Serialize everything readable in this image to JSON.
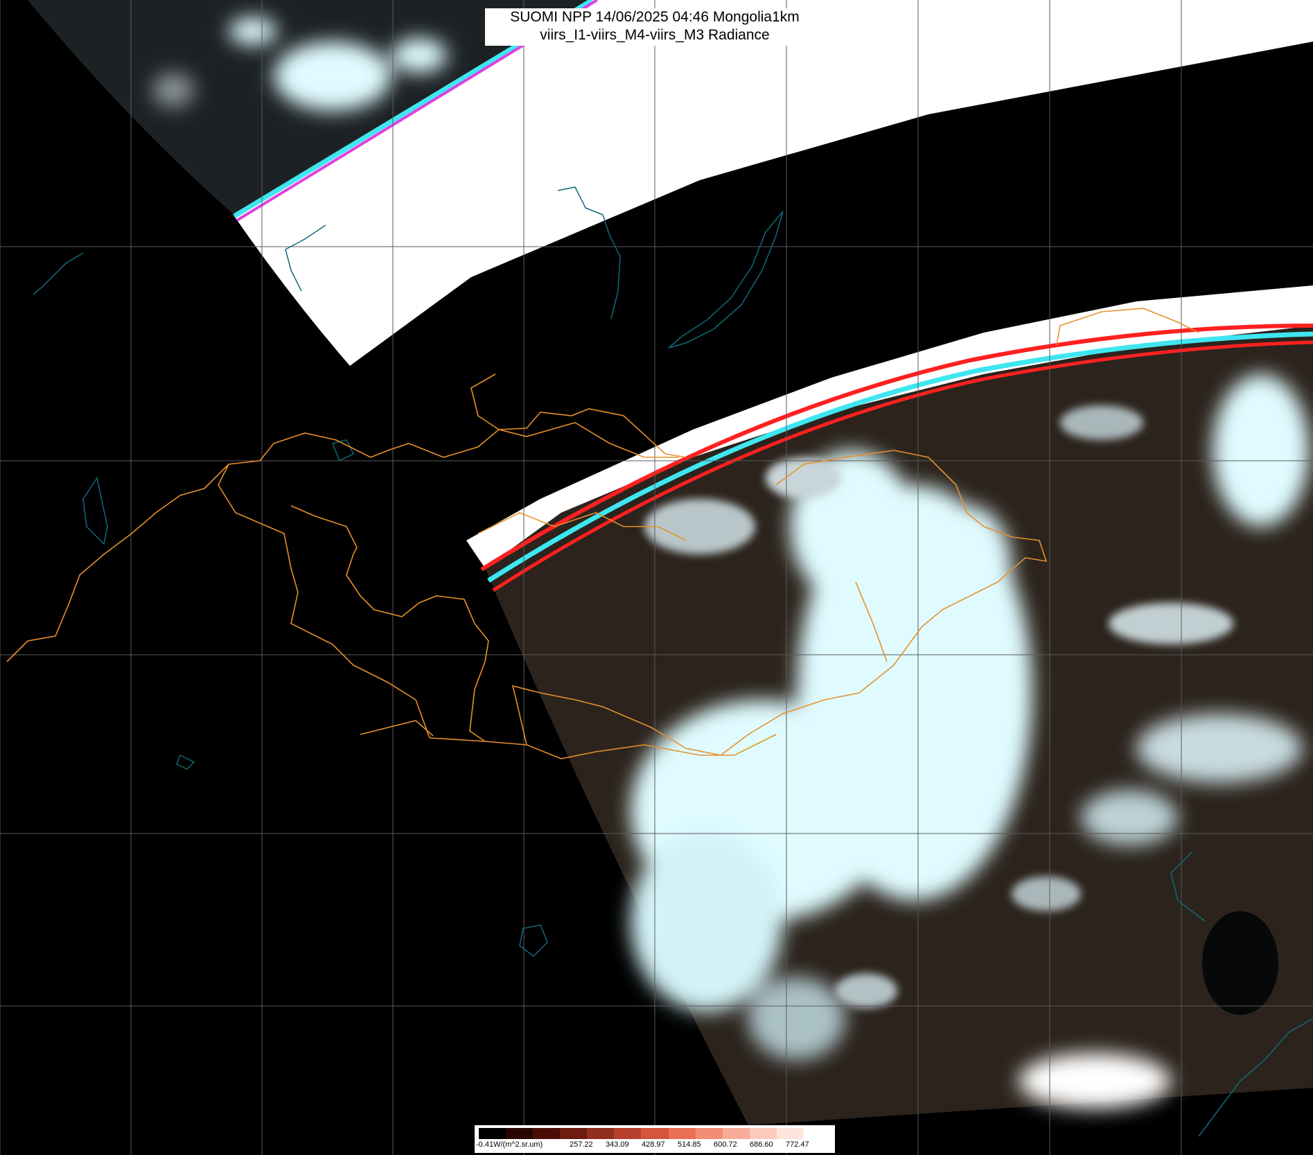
{
  "title": {
    "line1": "SUOMI NPP 14/06/2025 04:46 Mongolia1km",
    "line2": "viirs_I1-viirs_M4-viirs_M3 Radiance"
  },
  "colorbar": {
    "labels": [
      "-0.41W/(m^2.sr.um)",
      "257.22",
      "343.09",
      "428.97",
      "514.85",
      "600.72",
      "686.60",
      "772.47"
    ],
    "colors": [
      "#000000",
      "#2a0500",
      "#4a0d05",
      "#6e1c10",
      "#922e1d",
      "#b6402b",
      "#d4553d",
      "#ea6f55",
      "#f38d74",
      "#f8ac97",
      "#fccabb",
      "#fee5dc",
      "#ffffff"
    ]
  },
  "colors": {
    "graticule": "#5a5a5a",
    "border": "#e8902a",
    "coastline": "#0f6a78",
    "cloud": "#dffbff",
    "land": "#2b231c",
    "band_white": "#ffffff",
    "stripe_red": "#ff2020",
    "stripe_cyan": "#3fe6f0",
    "stripe_magenta": "#e040e0"
  }
}
